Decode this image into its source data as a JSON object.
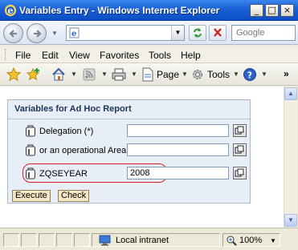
{
  "window": {
    "title": "Variables Entry - Windows Internet Explorer",
    "controls": [
      "_",
      "□",
      "×"
    ]
  },
  "address_bar": {
    "url_value": "",
    "search_placeholder": "Google"
  },
  "menu": {
    "items": [
      "File",
      "Edit",
      "View",
      "Favorites",
      "Tools",
      "Help"
    ]
  },
  "command_bar": {
    "page_label": "Page",
    "tools_label": "Tools",
    "overflow_label": "»"
  },
  "form": {
    "title": "Variables for Ad Hoc Report",
    "variables": [
      {
        "label": "Delegation (*)",
        "value": ""
      },
      {
        "label": "or an operational Area",
        "value": ""
      },
      {
        "label": "ZQSEYEAR",
        "value": "2008",
        "highlighted": true
      }
    ],
    "buttons": {
      "execute": "Execute",
      "check": "Check"
    }
  },
  "status_bar": {
    "zone": "Local intranet",
    "zoom": "100%"
  },
  "colors": {
    "title_bar": "#1a5fd6",
    "panel_bg": "#e7eef5",
    "highlight": "#d91e2a",
    "button_bg": "#f3e6c4"
  }
}
